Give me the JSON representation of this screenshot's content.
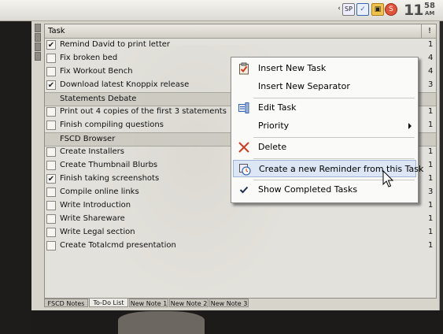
{
  "tray": {
    "icons": [
      "sp-icon",
      "notes-app-icon",
      "lock-icon",
      "dollar-icon"
    ],
    "clock_hour": "11",
    "clock_minute": "58",
    "clock_ampm": "AM"
  },
  "notes": {
    "header_title": "Task",
    "header_priority": "!",
    "rows": [
      {
        "type": "task",
        "label": "Remind David to print letter",
        "checked": true,
        "priority": "1"
      },
      {
        "type": "task",
        "label": "Fix broken bed",
        "checked": false,
        "priority": "4"
      },
      {
        "type": "task",
        "label": "Fix Workout Bench",
        "checked": false,
        "priority": "4"
      },
      {
        "type": "task",
        "label": "Download latest Knoppix release",
        "checked": true,
        "priority": "3"
      },
      {
        "type": "category",
        "label": "Statements Debate"
      },
      {
        "type": "task",
        "label": "Print out 4 copies of the first 3 statements",
        "checked": false,
        "priority": "1"
      },
      {
        "type": "task",
        "label": "Finish compiling questions",
        "checked": false,
        "priority": "1"
      },
      {
        "type": "category",
        "label": "FSCD Browser"
      },
      {
        "type": "task",
        "label": "Create Installers",
        "checked": false,
        "priority": "1"
      },
      {
        "type": "task",
        "label": "Create Thumbnail Blurbs",
        "checked": false,
        "priority": "1"
      },
      {
        "type": "task",
        "label": "Finish taking screenshots",
        "checked": true,
        "priority": "1"
      },
      {
        "type": "task",
        "label": "Compile online links",
        "checked": false,
        "priority": "3"
      },
      {
        "type": "task",
        "label": "Write Introduction",
        "checked": false,
        "priority": "1"
      },
      {
        "type": "task",
        "label": "Write Shareware",
        "checked": false,
        "priority": "1"
      },
      {
        "type": "task",
        "label": "Write Legal section",
        "checked": false,
        "priority": "1"
      },
      {
        "type": "task",
        "label": "Create Totalcmd presentation",
        "checked": false,
        "priority": "1"
      }
    ],
    "tabs": [
      {
        "label": "FSCD Notes",
        "active": false
      },
      {
        "label": "To-Do List",
        "active": true
      },
      {
        "label": "New Note 1",
        "active": false
      },
      {
        "label": "New Note 2",
        "active": false
      },
      {
        "label": "New Note 3",
        "active": false
      }
    ]
  },
  "context_menu": {
    "items": [
      {
        "label": "Insert New Task",
        "icon": "clipboard-check-icon"
      },
      {
        "label": "Insert New Separator",
        "icon": ""
      },
      {
        "label": "Edit Task",
        "icon": "edit-task-icon"
      },
      {
        "label": "Priority",
        "icon": "",
        "submenu": true
      },
      {
        "label": "Delete",
        "icon": "delete-x-icon"
      },
      {
        "label": "Create a new Reminder from this Task",
        "icon": "reminder-clock-icon",
        "highlighted": true
      },
      {
        "label": "Show Completed Tasks",
        "icon": "checkmark-icon",
        "checked": true
      }
    ]
  },
  "colors": {
    "menu_highlight": "#dce6f4",
    "delete_red": "#d23b1f",
    "accent_blue": "#3a66b0"
  }
}
